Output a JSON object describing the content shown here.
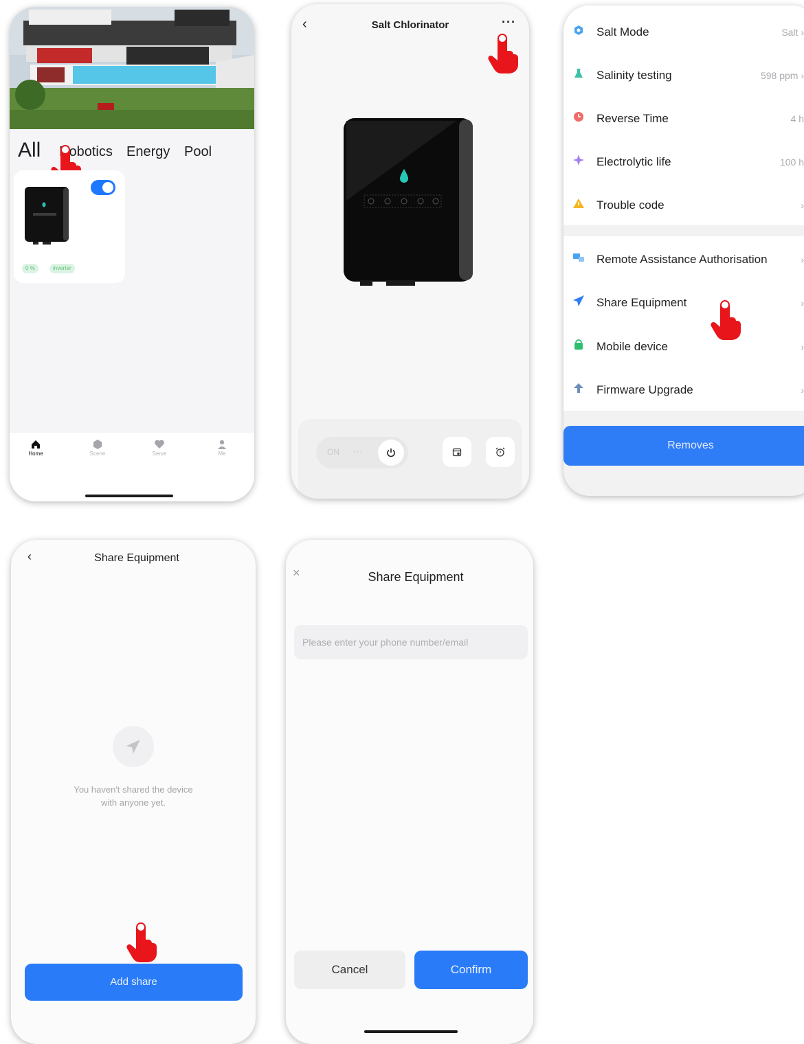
{
  "screen1": {
    "tabs": [
      "All",
      "Robotics",
      "Energy",
      "Pool"
    ],
    "card": {
      "toggle_on": true,
      "chips": [
        "0 %",
        "inverter"
      ]
    },
    "nav": [
      "Home",
      "Scene",
      "Serve",
      "Me"
    ]
  },
  "screen2": {
    "title": "Salt Chlorinator",
    "back_glyph": "‹",
    "more_glyph": "···",
    "controls": {
      "on_label": "ON",
      "mode_glyph": "‹‹‹"
    }
  },
  "screen3": {
    "settings": [
      {
        "label": "Salt Mode",
        "value": "Salt",
        "chevron": true,
        "icon": "salt-mode-icon",
        "color": "#4aa3f0"
      },
      {
        "label": "Salinity testing",
        "value": "598 ppm",
        "chevron": true,
        "icon": "flask-icon",
        "color": "#3bc2a3"
      },
      {
        "label": "Reverse Time",
        "value": "4 h",
        "chevron": false,
        "icon": "clock-icon",
        "color": "#f06a6a"
      },
      {
        "label": "Electrolytic life",
        "value": "100 h",
        "chevron": false,
        "icon": "electrolytic-icon",
        "color": "#a77ef0"
      },
      {
        "label": "Trouble code",
        "value": "",
        "chevron": true,
        "icon": "warning-icon",
        "color": "#f5b623"
      }
    ],
    "actions": [
      {
        "label": "Remote Assistance Authorisation",
        "icon": "remote-assist-icon",
        "color": "#4aa3f0"
      },
      {
        "label": "Share Equipment",
        "icon": "send-icon",
        "color": "#2f7cf6"
      },
      {
        "label": "Mobile device",
        "icon": "mobile-device-icon",
        "color": "#2dbf6f"
      },
      {
        "label": "Firmware Upgrade",
        "icon": "upgrade-icon",
        "color": "#6e8fb8"
      }
    ],
    "remove_label": "Removes"
  },
  "screen4": {
    "title": "Share Equipment",
    "back_glyph": "‹",
    "empty_line1": "You haven't shared the device",
    "empty_line2": "with anyone yet.",
    "add_label": "Add share"
  },
  "screen5": {
    "title": "Share Equipment",
    "close_glyph": "×",
    "placeholder": "Please enter your phone number/email",
    "cancel_label": "Cancel",
    "confirm_label": "Confirm"
  },
  "colors": {
    "accent": "#2a7bf7",
    "pointer": "#e8151b"
  }
}
